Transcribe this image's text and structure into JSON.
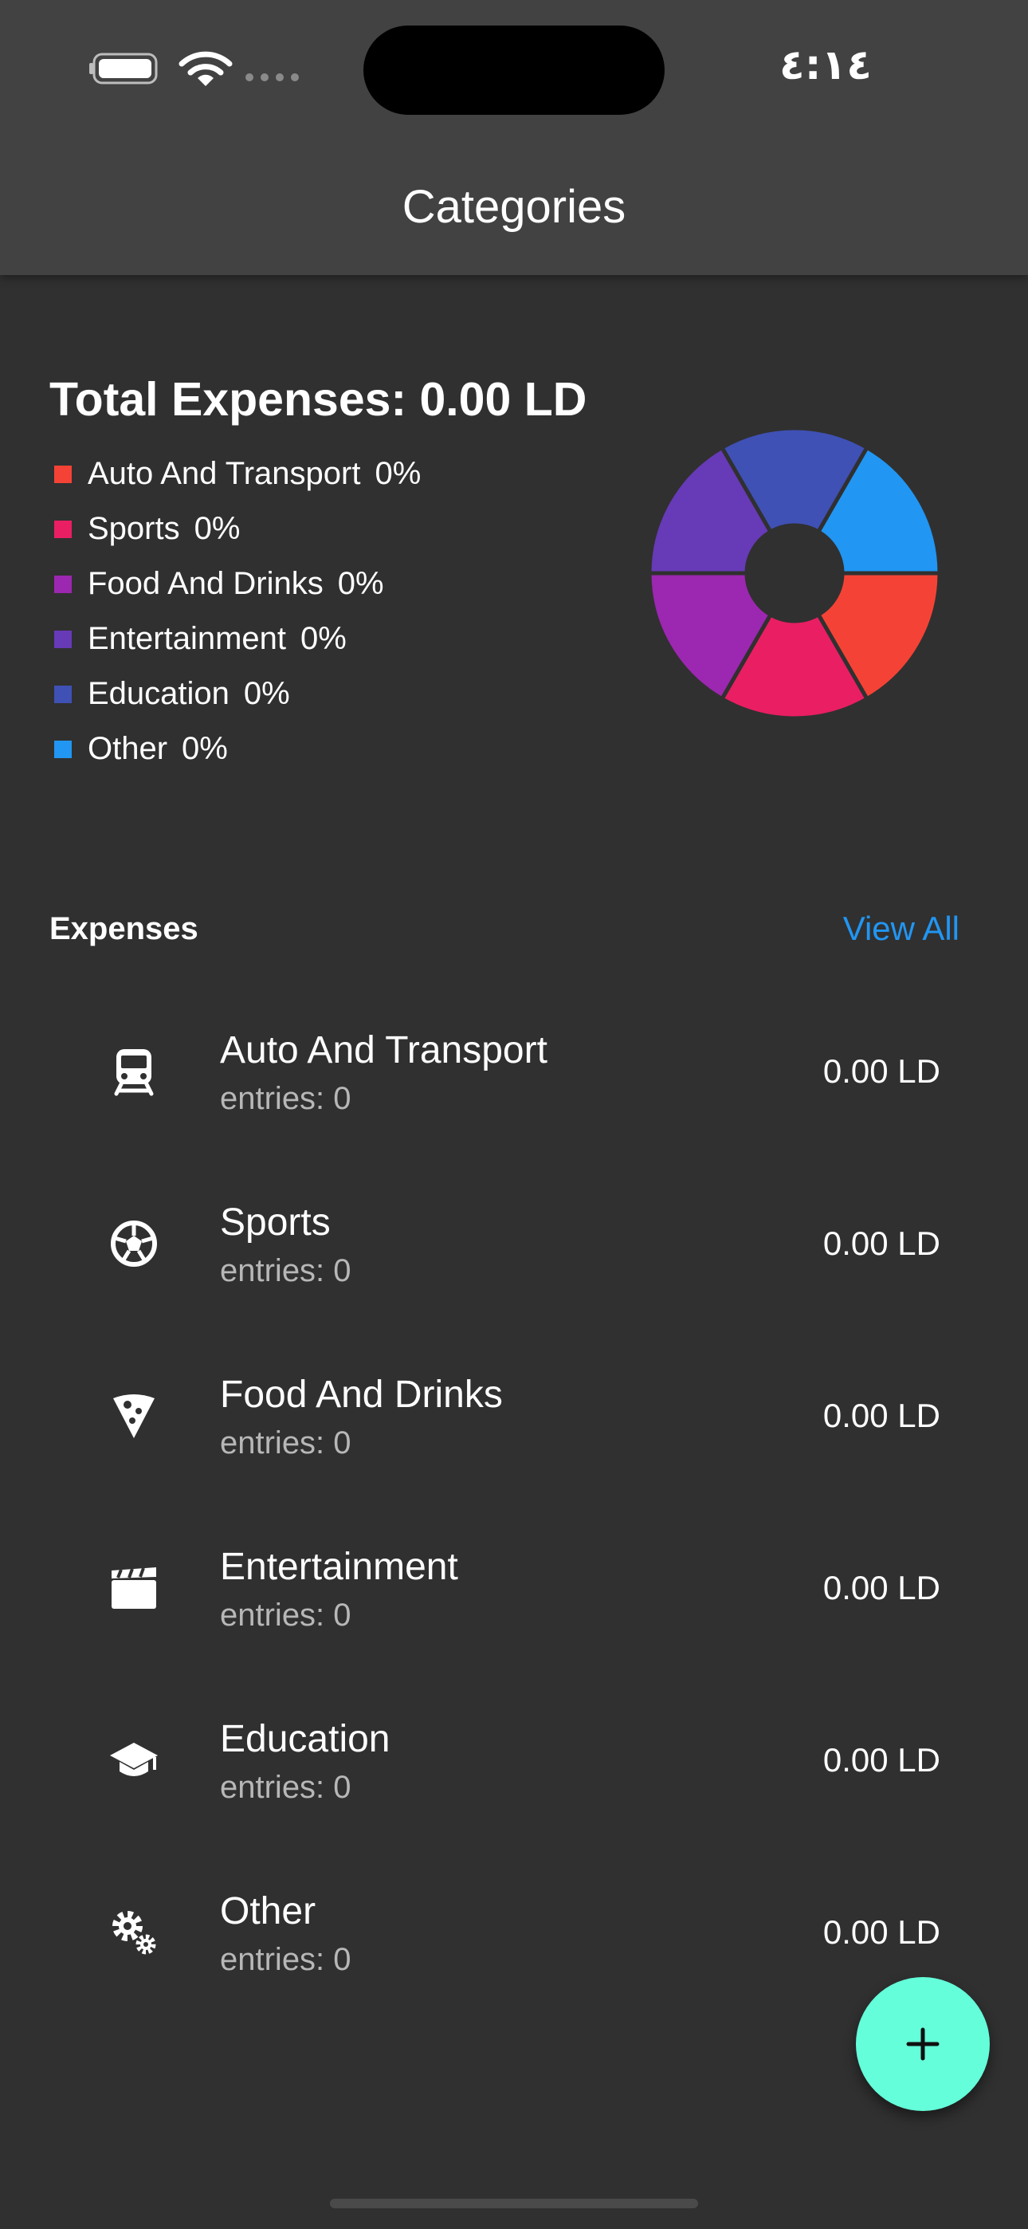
{
  "status_bar": {
    "time": "٤:١٤",
    "icons": [
      "battery-icon",
      "wifi-icon",
      "signal-dots-icon"
    ]
  },
  "app_bar": {
    "title": "Categories"
  },
  "summary": {
    "total_label": "Total Expenses: 0.00 LD",
    "legend": [
      {
        "label": "Auto And Transport",
        "percent": "0%",
        "color": "#f44336"
      },
      {
        "label": "Sports",
        "percent": "0%",
        "color": "#e91e63"
      },
      {
        "label": "Food And Drinks",
        "percent": "0%",
        "color": "#9c27b0"
      },
      {
        "label": "Entertainment",
        "percent": "0%",
        "color": "#673ab7"
      },
      {
        "label": "Education",
        "percent": "0%",
        "color": "#3f51b5"
      },
      {
        "label": "Other",
        "percent": "0%",
        "color": "#2196f3"
      }
    ]
  },
  "chart_data": {
    "type": "pie",
    "style": "donut",
    "categories": [
      "Auto And Transport",
      "Sports",
      "Food And Drinks",
      "Entertainment",
      "Education",
      "Other"
    ],
    "values": [
      0,
      0,
      0,
      0,
      0,
      0
    ],
    "colors": [
      "#f44336",
      "#e91e63",
      "#9c27b0",
      "#673ab7",
      "#3f51b5",
      "#2196f3"
    ],
    "note_equal_display": true
  },
  "expenses": {
    "section_title": "Expenses",
    "view_all_label": "View All",
    "items": [
      {
        "title": "Auto And Transport",
        "entries": "entries: 0",
        "amount": "0.00 LD",
        "icon": "train-icon"
      },
      {
        "title": "Sports",
        "entries": "entries: 0",
        "amount": "0.00 LD",
        "icon": "soccer-ball-icon"
      },
      {
        "title": "Food And Drinks",
        "entries": "entries: 0",
        "amount": "0.00 LD",
        "icon": "pizza-icon"
      },
      {
        "title": "Entertainment",
        "entries": "entries: 0",
        "amount": "0.00 LD",
        "icon": "clapperboard-icon"
      },
      {
        "title": "Education",
        "entries": "entries: 0",
        "amount": "0.00 LD",
        "icon": "graduation-cap-icon"
      },
      {
        "title": "Other",
        "entries": "entries: 0",
        "amount": "0.00 LD",
        "icon": "gears-icon"
      }
    ]
  },
  "fab": {
    "icon": "plus-icon",
    "color": "#64ffda"
  }
}
